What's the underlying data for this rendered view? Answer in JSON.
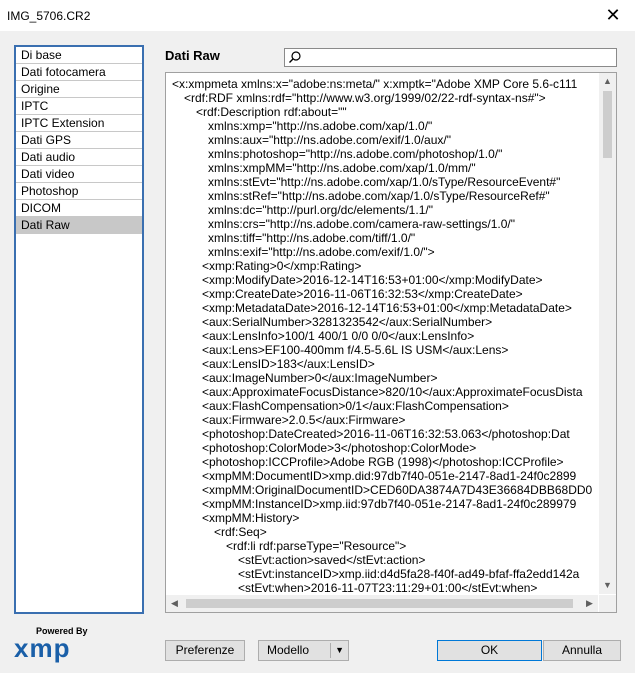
{
  "window": {
    "title": "IMG_5706.CR2",
    "close_symbol": "✕"
  },
  "sidebar": {
    "items": [
      {
        "label": "Di base",
        "selected": false
      },
      {
        "label": "Dati fotocamera",
        "selected": false
      },
      {
        "label": "Origine",
        "selected": false
      },
      {
        "label": "IPTC",
        "selected": false
      },
      {
        "label": "IPTC Extension",
        "selected": false
      },
      {
        "label": "Dati GPS",
        "selected": false
      },
      {
        "label": "Dati audio",
        "selected": false
      },
      {
        "label": "Dati video",
        "selected": false
      },
      {
        "label": "Photoshop",
        "selected": false
      },
      {
        "label": "DICOM",
        "selected": false
      },
      {
        "label": "Dati Raw",
        "selected": true
      }
    ]
  },
  "main": {
    "section_title": "Dati Raw",
    "search": {
      "value": "",
      "placeholder": "",
      "icon": "search-icon"
    },
    "xml_lines": [
      {
        "indent": 0,
        "text": "<x:xmpmeta xmlns:x=\"adobe:ns:meta/\" x:xmptk=\"Adobe XMP Core 5.6-c111"
      },
      {
        "indent": 1,
        "text": "<rdf:RDF xmlns:rdf=\"http://www.w3.org/1999/02/22-rdf-syntax-ns#\">"
      },
      {
        "indent": 2,
        "text": "<rdf:Description rdf:about=\"\""
      },
      {
        "indent": 3,
        "text": "xmlns:xmp=\"http://ns.adobe.com/xap/1.0/\""
      },
      {
        "indent": 3,
        "text": "xmlns:aux=\"http://ns.adobe.com/exif/1.0/aux/\""
      },
      {
        "indent": 3,
        "text": "xmlns:photoshop=\"http://ns.adobe.com/photoshop/1.0/\""
      },
      {
        "indent": 3,
        "text": "xmlns:xmpMM=\"http://ns.adobe.com/xap/1.0/mm/\""
      },
      {
        "indent": 3,
        "text": "xmlns:stEvt=\"http://ns.adobe.com/xap/1.0/sType/ResourceEvent#\""
      },
      {
        "indent": 3,
        "text": "xmlns:stRef=\"http://ns.adobe.com/xap/1.0/sType/ResourceRef#\""
      },
      {
        "indent": 3,
        "text": "xmlns:dc=\"http://purl.org/dc/elements/1.1/\""
      },
      {
        "indent": 3,
        "text": "xmlns:crs=\"http://ns.adobe.com/camera-raw-settings/1.0/\""
      },
      {
        "indent": 3,
        "text": "xmlns:tiff=\"http://ns.adobe.com/tiff/1.0/\""
      },
      {
        "indent": 3,
        "text": "xmlns:exif=\"http://ns.adobe.com/exif/1.0/\">"
      },
      {
        "indent": 2.5,
        "text": "<xmp:Rating>0</xmp:Rating>"
      },
      {
        "indent": 2.5,
        "text": "<xmp:ModifyDate>2016-12-14T16:53+01:00</xmp:ModifyDate>"
      },
      {
        "indent": 2.5,
        "text": "<xmp:CreateDate>2016-11-06T16:32:53</xmp:CreateDate>"
      },
      {
        "indent": 2.5,
        "text": "<xmp:MetadataDate>2016-12-14T16:53+01:00</xmp:MetadataDate>"
      },
      {
        "indent": 2.5,
        "text": "<aux:SerialNumber>3281323542</aux:SerialNumber>"
      },
      {
        "indent": 2.5,
        "text": "<aux:LensInfo>100/1 400/1 0/0 0/0</aux:LensInfo>"
      },
      {
        "indent": 2.5,
        "text": "<aux:Lens>EF100-400mm f/4.5-5.6L IS USM</aux:Lens>"
      },
      {
        "indent": 2.5,
        "text": "<aux:LensID>183</aux:LensID>"
      },
      {
        "indent": 2.5,
        "text": "<aux:ImageNumber>0</aux:ImageNumber>"
      },
      {
        "indent": 2.5,
        "text": "<aux:ApproximateFocusDistance>820/10</aux:ApproximateFocusDista"
      },
      {
        "indent": 2.5,
        "text": "<aux:FlashCompensation>0/1</aux:FlashCompensation>"
      },
      {
        "indent": 2.5,
        "text": "<aux:Firmware>2.0.5</aux:Firmware>"
      },
      {
        "indent": 2.5,
        "text": "<photoshop:DateCreated>2016-11-06T16:32:53.063</photoshop:Dat"
      },
      {
        "indent": 2.5,
        "text": "<photoshop:ColorMode>3</photoshop:ColorMode>"
      },
      {
        "indent": 2.5,
        "text": "<photoshop:ICCProfile>Adobe RGB (1998)</photoshop:ICCProfile>"
      },
      {
        "indent": 2.5,
        "text": "<xmpMM:DocumentID>xmp.did:97db7f40-051e-2147-8ad1-24f0c2899"
      },
      {
        "indent": 2.5,
        "text": "<xmpMM:OriginalDocumentID>CED60DA3874A7D43E36684DBB68DD0"
      },
      {
        "indent": 2.5,
        "text": "<xmpMM:InstanceID>xmp.iid:97db7f40-051e-2147-8ad1-24f0c289979"
      },
      {
        "indent": 2.5,
        "text": "<xmpMM:History>"
      },
      {
        "indent": 3.5,
        "text": "<rdf:Seq>"
      },
      {
        "indent": 4.5,
        "text": "<rdf:li rdf:parseType=\"Resource\">"
      },
      {
        "indent": 5.5,
        "text": "<stEvt:action>saved</stEvt:action>"
      },
      {
        "indent": 5.5,
        "text": "<stEvt:instanceID>xmp.iid:d4d5fa28-f40f-ad49-bfaf-ffa2edd142a"
      },
      {
        "indent": 5.5,
        "text": "<stEvt:when>2016-11-07T23:11:29+01:00</stEvt:when>"
      }
    ]
  },
  "scrollbars": {
    "up": "▲",
    "down": "▼",
    "left": "◀",
    "right": "▶"
  },
  "branding": {
    "powered_by": "Powered By",
    "logo_text": "xmp",
    "logo_color": "#1a5fa8"
  },
  "footer": {
    "preferences_label": "Preferenze",
    "model_label": "Modello",
    "model_arrow": "▼",
    "ok_label": "OK",
    "cancel_label": "Annulla"
  }
}
